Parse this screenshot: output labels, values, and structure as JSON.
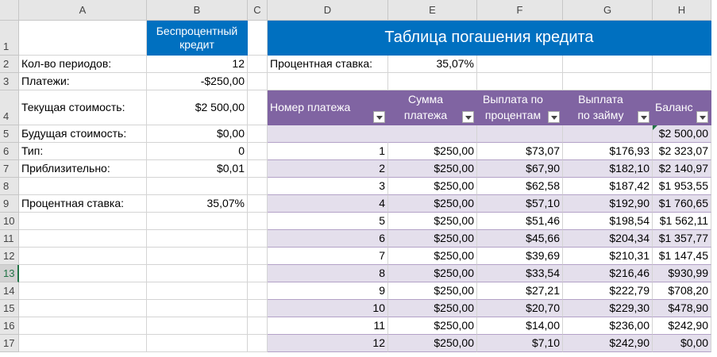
{
  "column_headers": [
    "A",
    "B",
    "C",
    "D",
    "E",
    "F",
    "G",
    "H"
  ],
  "row_numbers": [
    "1",
    "2",
    "3",
    "4",
    "5",
    "6",
    "7",
    "8",
    "9",
    "10",
    "11",
    "12",
    "13",
    "14",
    "15",
    "16",
    "17"
  ],
  "active_row": "13",
  "header_cell": {
    "line1": "Беспроцентный",
    "line2": "кредит"
  },
  "banner_title": "Таблица погашения кредита",
  "left_rows": [
    {
      "label": "Кол-во периодов:",
      "value": "12"
    },
    {
      "label": "Платежи:",
      "value": "-$250,00"
    },
    {
      "label": "Текущая стоимость:",
      "value": "$2 500,00"
    },
    {
      "label": "Будущая стоимость:",
      "value": "$0,00"
    },
    {
      "label": "Тип:",
      "value": "0"
    },
    {
      "label": "Приблизительно:",
      "value": "$0,01"
    },
    {
      "label": "",
      "value": ""
    },
    {
      "label": "Процентная ставка:",
      "value": "35,07%"
    }
  ],
  "rate_row": {
    "label": "Процентная ставка:",
    "value": "35,07%"
  },
  "table_headers": [
    {
      "line1": "Номер платежа",
      "line2": ""
    },
    {
      "line1": "Сумма",
      "line2": "платежа"
    },
    {
      "line1": "Выплата по",
      "line2": "процентам"
    },
    {
      "line1": "Выплата",
      "line2": "по займу"
    },
    {
      "line1": "Баланс",
      "line2": ""
    }
  ],
  "initial_balance": "$2 500,00",
  "table_rows": [
    [
      "1",
      "$250,00",
      "$73,07",
      "$176,93",
      "$2 323,07"
    ],
    [
      "2",
      "$250,00",
      "$67,90",
      "$182,10",
      "$2 140,97"
    ],
    [
      "3",
      "$250,00",
      "$62,58",
      "$187,42",
      "$1 953,55"
    ],
    [
      "4",
      "$250,00",
      "$57,10",
      "$192,90",
      "$1 760,65"
    ],
    [
      "5",
      "$250,00",
      "$51,46",
      "$198,54",
      "$1 562,11"
    ],
    [
      "6",
      "$250,00",
      "$45,66",
      "$204,34",
      "$1 357,77"
    ],
    [
      "7",
      "$250,00",
      "$39,69",
      "$210,31",
      "$1 147,45"
    ],
    [
      "8",
      "$250,00",
      "$33,54",
      "$216,46",
      "$930,99"
    ],
    [
      "9",
      "$250,00",
      "$27,21",
      "$222,79",
      "$708,20"
    ],
    [
      "10",
      "$250,00",
      "$20,70",
      "$229,30",
      "$478,90"
    ],
    [
      "11",
      "$250,00",
      "$14,00",
      "$236,00",
      "$242,90"
    ],
    [
      "12",
      "$250,00",
      "$7,10",
      "$242,90",
      "$0,00"
    ]
  ],
  "colors": {
    "banner_blue": "#0070c0",
    "table_header_purple": "#8064a2",
    "band_light": "#e4dfec",
    "excel_green": "#217346"
  },
  "icons": {
    "filter": "filter-dropdown-icon"
  }
}
